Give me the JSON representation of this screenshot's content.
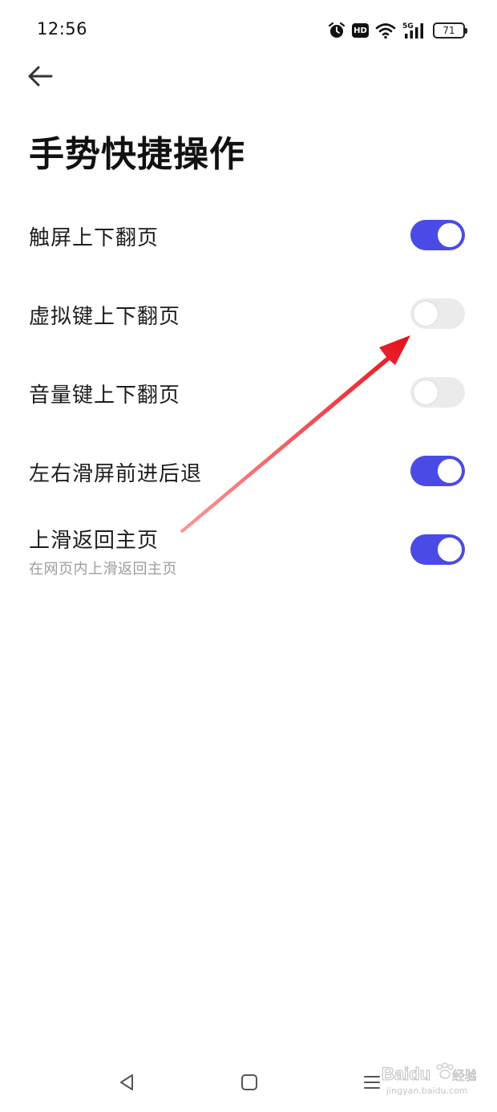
{
  "status_bar": {
    "time": "12:56",
    "hd": "HD",
    "network": "5G",
    "battery": "71",
    "icons": [
      "alarm-icon",
      "hd-icon",
      "wifi-icon",
      "5g-signal-icon",
      "battery-icon"
    ]
  },
  "header": {
    "back_icon": "back-arrow-icon",
    "title": "手势快捷操作"
  },
  "settings": [
    {
      "label": "触屏上下翻页",
      "description": "",
      "enabled": true
    },
    {
      "label": "虚拟键上下翻页",
      "description": "",
      "enabled": false
    },
    {
      "label": "音量键上下翻页",
      "description": "",
      "enabled": false
    },
    {
      "label": "左右滑屏前进后退",
      "description": "",
      "enabled": true
    },
    {
      "label": "上滑返回主页",
      "description": "在网页内上滑返回主页",
      "enabled": true
    }
  ],
  "colors": {
    "switch_on": "#4a4be6",
    "switch_off": "#ebebeb",
    "annotation_arrow": "#e8121c"
  },
  "nav_bar": {
    "icons": [
      "back-triangle-icon",
      "home-square-icon",
      "menu-lines-icon"
    ]
  },
  "watermark": {
    "brand": "Baidu",
    "suffix": "经验",
    "url": "jingyan.baidu.com"
  }
}
